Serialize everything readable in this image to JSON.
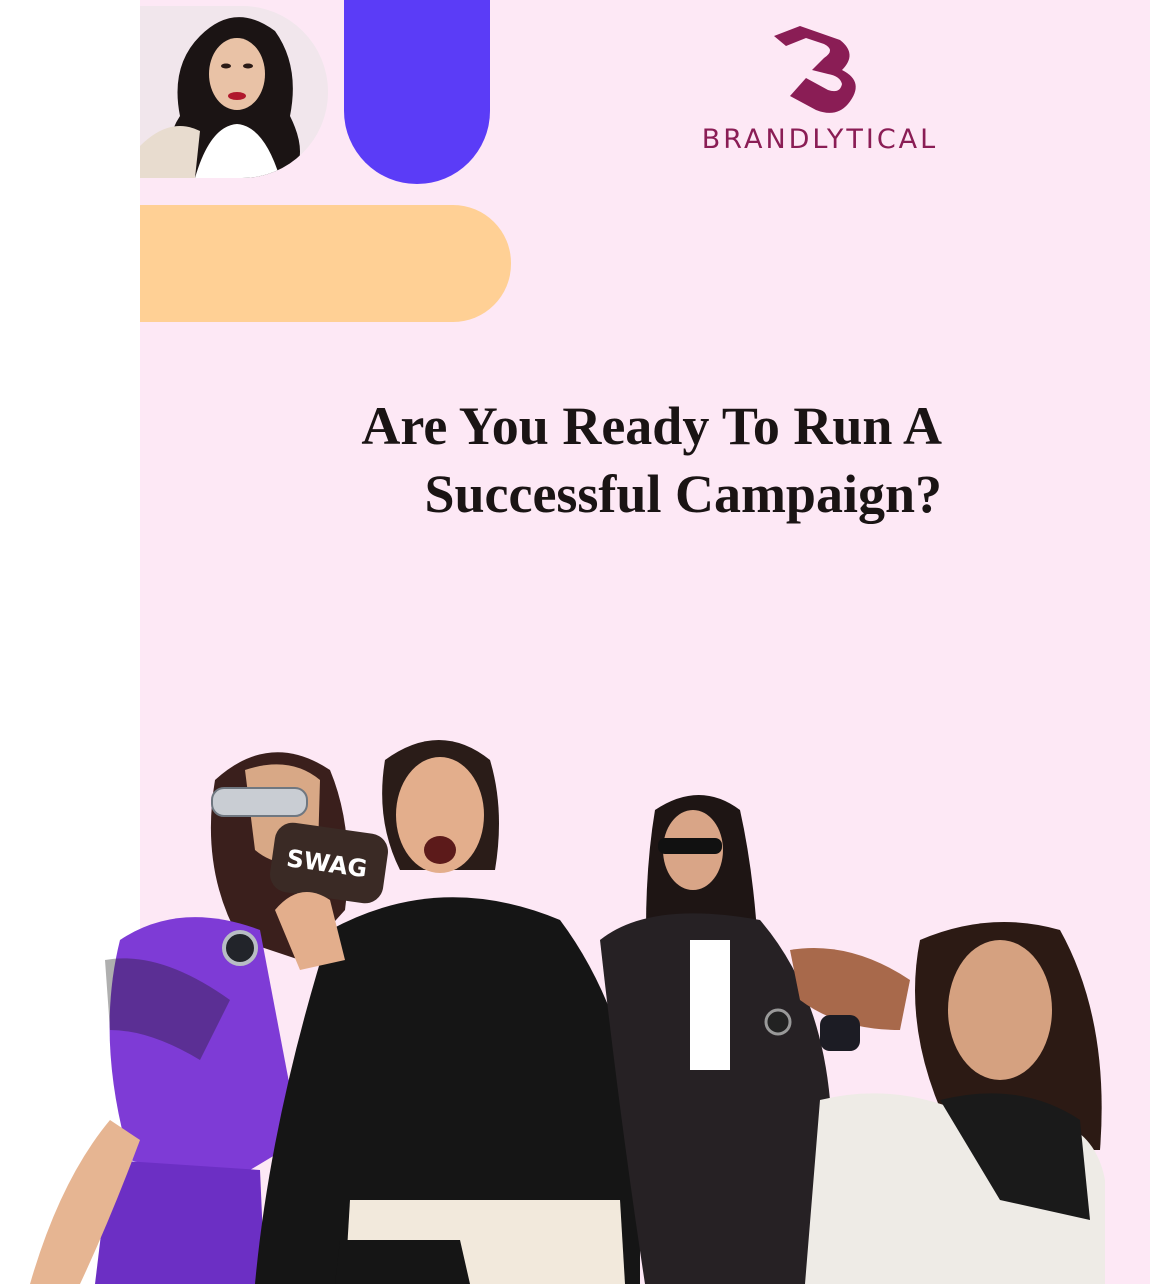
{
  "brand": {
    "name": "BRANDLYTICAL",
    "accent_color": "#8a1d55",
    "purple_shape_color": "#5b3cf7",
    "peach_shape_color": "#ffd095",
    "background_color": "#fde8f5"
  },
  "headline": {
    "line1": "Are You Ready To Run A",
    "line2": "Successful Campaign?"
  },
  "photo_text": {
    "sunglasses_case": "SWAG"
  }
}
